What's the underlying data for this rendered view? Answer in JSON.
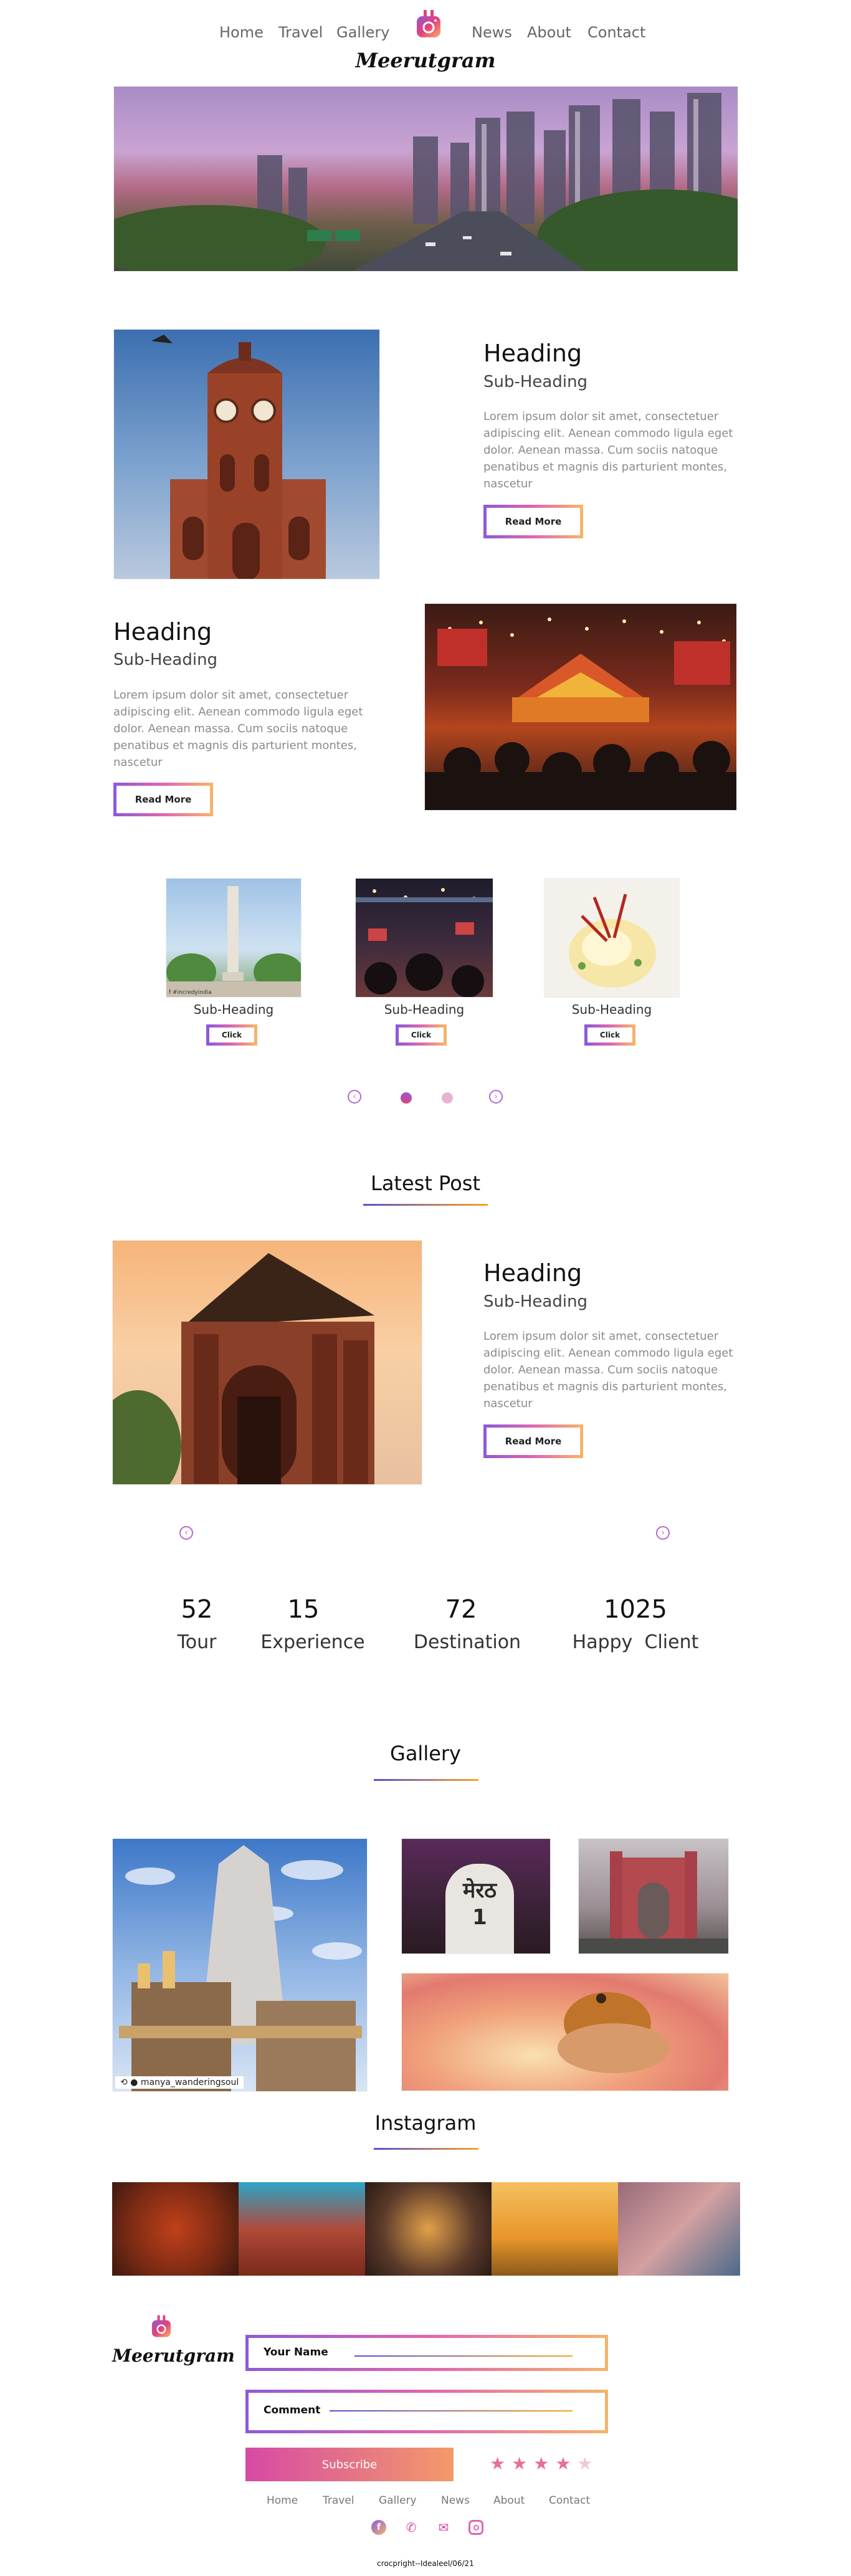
{
  "nav": {
    "left": [
      "Home",
      "Travel",
      "Gallery"
    ],
    "right": [
      "News",
      "About",
      "Contact"
    ],
    "brand": "Meerutgram"
  },
  "feature1": {
    "heading": "Heading",
    "subheading": "Sub-Heading",
    "body": "Lorem ipsum dolor sit amet, consectetuer adipiscing elit. Aenean commodo ligula eget dolor. Aenean massa. Cum sociis natoque penatibus et magnis dis parturient montes, nascetur",
    "button": "Read More"
  },
  "feature2": {
    "heading": "Heading",
    "subheading": "Sub-Heading",
    "body": "Lorem ipsum dolor sit amet, consectetuer adipiscing elit. Aenean commodo ligula eget dolor. Aenean massa. Cum sociis natoque penatibus et magnis dis parturient montes, nascetur",
    "button": "Read More"
  },
  "cards": [
    {
      "subheading": "Sub-Heading",
      "button": "Click",
      "caption": "f #incredyindia"
    },
    {
      "subheading": "Sub-Heading",
      "button": "Click"
    },
    {
      "subheading": "Sub-Heading",
      "button": "Click"
    }
  ],
  "carousel": {
    "prev": "‹",
    "next": "›"
  },
  "latest": {
    "title": "Latest Post",
    "heading": "Heading",
    "subheading": "Sub-Heading",
    "body": "Lorem ipsum dolor sit amet, consectetuer adipiscing elit. Aenean commodo ligula eget dolor. Aenean massa. Cum sociis natoque penatibus et magnis dis parturient montes, nascetur",
    "button": "Read More"
  },
  "stats": [
    {
      "value": "52",
      "label": "Tour"
    },
    {
      "value": "15",
      "label": "Experience"
    },
    {
      "value": "72",
      "label": "Destination"
    },
    {
      "value": "1025",
      "label": "Happy  Client"
    }
  ],
  "gallery": {
    "title": "Gallery",
    "caption": "manya_wanderingsoul",
    "sign_text": "मेरठ",
    "sign_num": "1"
  },
  "instagram": {
    "title": "Instagram"
  },
  "footer": {
    "brand": "Meerutgram",
    "name_placeholder": "Your Name",
    "comment_placeholder": "Comment",
    "subscribe": "Subscribe",
    "stars": "★★★★★",
    "links": [
      "Home",
      "Travel",
      "Gallery",
      "News",
      "About",
      "Contact"
    ],
    "copyright": "crocpright--Idealeel/06/21"
  },
  "colors": {
    "accent_start": "#8e5ad6",
    "accent_mid": "#e066b0",
    "accent_end": "#f6b26b",
    "star": "#e8708f"
  }
}
